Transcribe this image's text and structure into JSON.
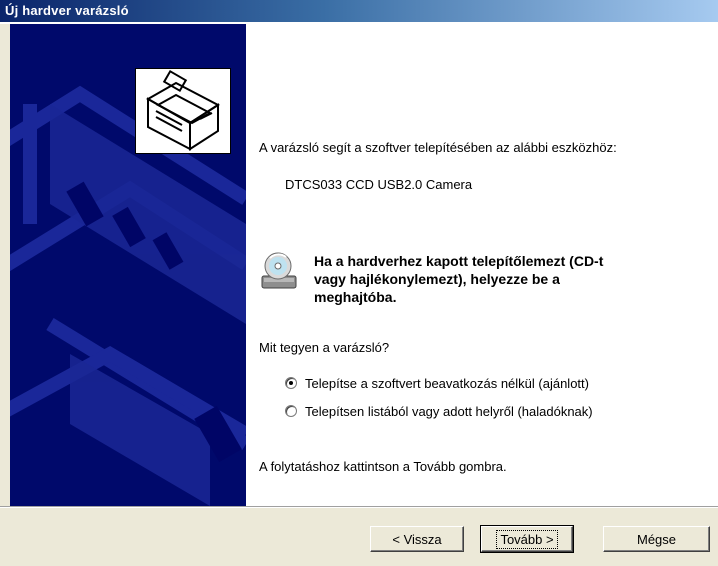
{
  "window": {
    "title": "Új hardver varázsló"
  },
  "content": {
    "intro": "A varázsló segít a szoftver telepítésében az alábbi eszközhöz:",
    "device_name": "DTCS033 CCD USB2.0 Camera",
    "cd_message_line1": "Ha a hardverhez kapott telepítőlemezt (CD-t",
    "cd_message_line2": "vagy hajlékonylemezt), helyezze be a",
    "cd_message_line3": "meghajtóba.",
    "question": "Mit tegyen a varázsló?",
    "options": [
      {
        "label": "Telepítse a szoftvert beavatkozás nélkül (ajánlott)",
        "selected": true
      },
      {
        "label": "Telepítsen listából vagy adott helyről (haladóknak)",
        "selected": false
      }
    ],
    "continue_hint": "A folytatáshoz kattintson a Tovább gombra."
  },
  "buttons": {
    "back": "< Vissza",
    "next": "Tovább >",
    "cancel": "Mégse"
  },
  "icons": {
    "hardware": "hardware-wizard-icon",
    "cd": "cd-drive-icon"
  },
  "colors": {
    "title_start": "#0A246A",
    "title_end": "#A6CAF0",
    "panel": "#00096B",
    "dialog_bg": "#ECE9D8"
  }
}
